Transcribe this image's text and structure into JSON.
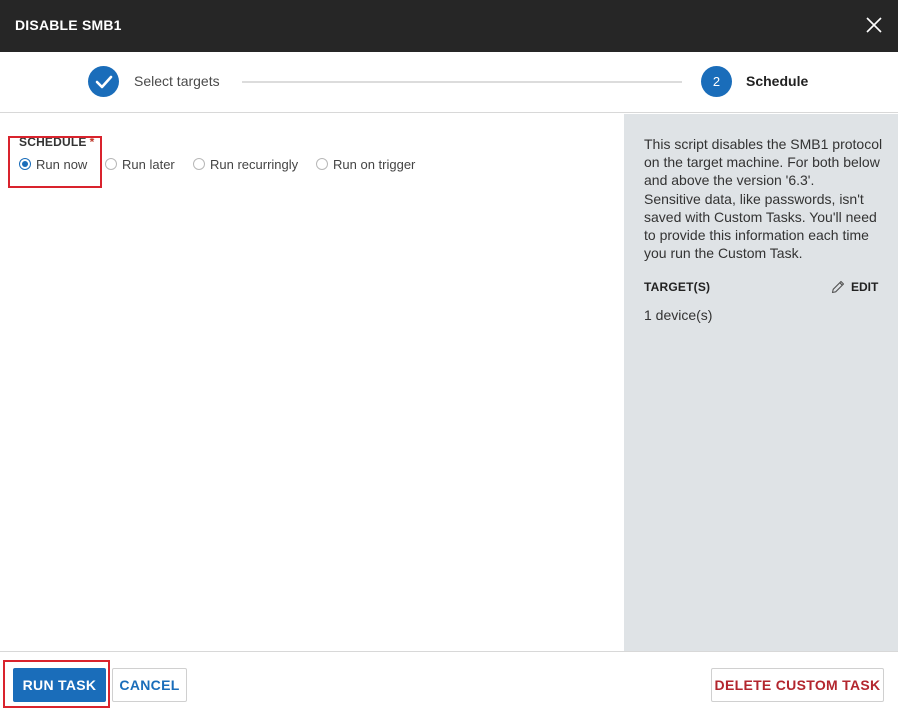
{
  "dialog": {
    "title": "DISABLE SMB1"
  },
  "stepper": {
    "steps": [
      {
        "label": "Select targets",
        "state": "completed",
        "indicator": "check-icon"
      },
      {
        "label": "Schedule",
        "state": "active",
        "number": "2"
      }
    ]
  },
  "schedule": {
    "label": "SCHEDULE",
    "required_mark": "*",
    "options": [
      {
        "label": "Run now",
        "checked": true
      },
      {
        "label": "Run later",
        "checked": false
      },
      {
        "label": "Run recurringly",
        "checked": false
      },
      {
        "label": "Run on trigger",
        "checked": false
      }
    ]
  },
  "sidebar": {
    "description_1": "This script disables the SMB1 protocol on the target machine. For both below and above the version '6.3'.",
    "description_2": "Sensitive data, like passwords, isn't saved with Custom Tasks. You'll need to provide this information each time you run the Custom Task.",
    "targets_label": "TARGET(S)",
    "edit_label": "EDIT",
    "targets_value": "1 device(s)"
  },
  "footer": {
    "run_label": "RUN TASK",
    "cancel_label": "CANCEL",
    "delete_label": "DELETE CUSTOM TASK"
  },
  "colors": {
    "titlebar": "#262626",
    "accent": "#1a6dba",
    "sidebar_bg": "#dfe3e6",
    "danger": "#b3262e",
    "highlight": "#d9232d"
  }
}
